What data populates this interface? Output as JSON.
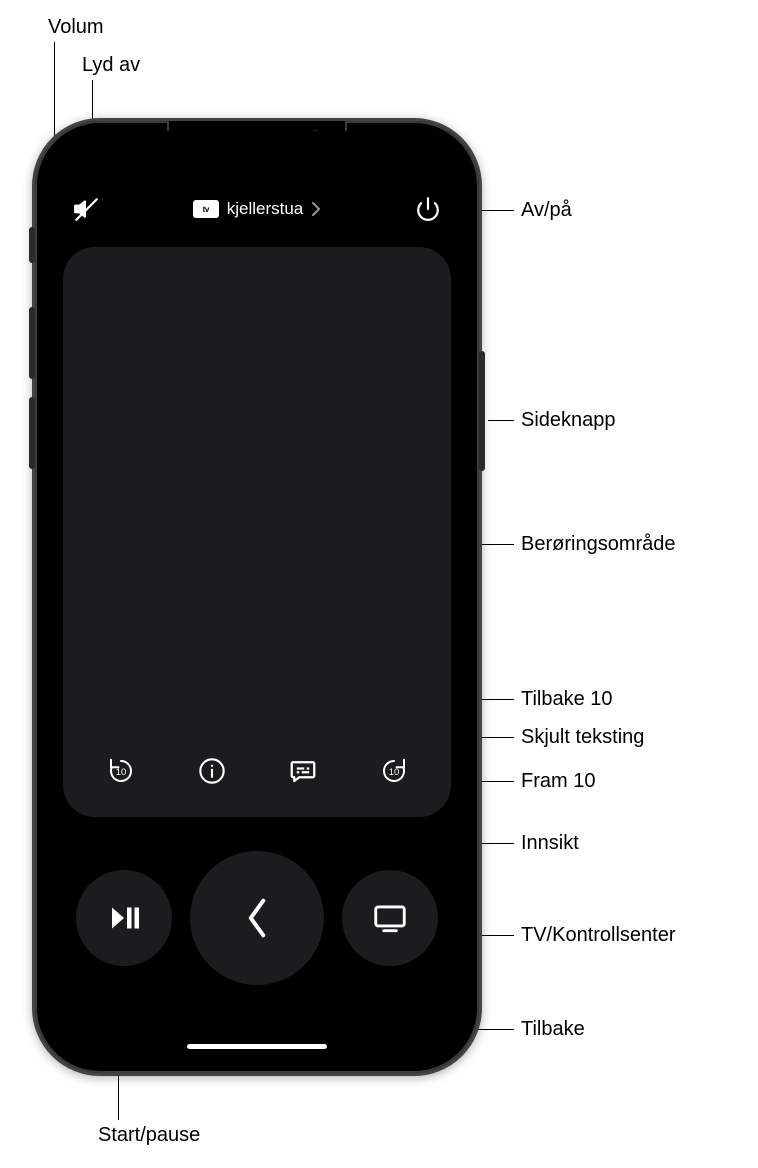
{
  "callouts": {
    "volume": "Volum",
    "mute": "Lyd av",
    "power": "Av/på",
    "side_button": "Sideknapp",
    "touch_area": "Berøringsområde",
    "back10": "Tilbake 10",
    "cc": "Skjult teksting",
    "fwd10": "Fram 10",
    "insight": "Innsikt",
    "tv_control": "TV/Kontrollsenter",
    "back": "Tilbake",
    "play_pause": "Start/pause"
  },
  "remote": {
    "device_name": "kjellerstua",
    "badge": "tv"
  }
}
